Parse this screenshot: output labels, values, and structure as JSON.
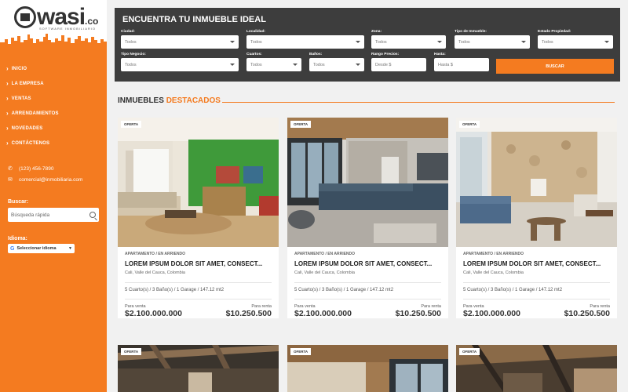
{
  "brand": {
    "name": "wasi",
    "suffix": ".co",
    "tagline": "SOFTWARE INMOBILIARIO"
  },
  "sidebar": {
    "nav": [
      {
        "label": "INICIO"
      },
      {
        "label": "LA EMPRESA"
      },
      {
        "label": "VENTAS"
      },
      {
        "label": "ARRENDAMIENTOS"
      },
      {
        "label": "NOVEDADES"
      },
      {
        "label": "CONTÁCTENOS"
      }
    ],
    "phone": "(123) 456-7890",
    "email": "comercial@inmobiliaria.com",
    "search_label": "Buscar:",
    "search_placeholder": "Búsqueda rápida",
    "language_label": "Idioma:",
    "language_select": "Seleccionar idioma"
  },
  "search": {
    "title": "ENCUENTRA TU INMUEBLE IDEAL",
    "fields": [
      {
        "label": "Ciudad:",
        "value": "Todos"
      },
      {
        "label": "Localidad:",
        "value": "Todos"
      },
      {
        "label": "Zona:",
        "value": "Todos"
      },
      {
        "label": "Tipo de Inmueble:",
        "value": "Todos"
      },
      {
        "label": "Estado Propiedad:",
        "value": "Todos"
      },
      {
        "label": "Tipo Negocio:",
        "value": "Todos"
      },
      {
        "label": "Cuartos:",
        "value": "Todos"
      },
      {
        "label": "Baños:",
        "value": "Todos"
      },
      {
        "label": "Rango Precios:",
        "value": "Desde $"
      },
      {
        "label": "Hasta:",
        "value": "Hasta $"
      }
    ],
    "button": "BUSCAR"
  },
  "featured": {
    "title": "INMUEBLES",
    "accent": "DESTACADOS"
  },
  "cards": [
    {
      "badge": "OFERTA",
      "type": "APARTAMENTO / EN ARRIENDO",
      "title": "LOREM IPSUM DOLOR SIT AMET, CONSECT...",
      "location": "Cali, Valle del Cauca, Colombia",
      "features": "5 Cuarto(s) / 3 Baño(s) / 1 Garage / 147.12 mt2",
      "sale_label": "Para venta",
      "sale_price": "$2.100.000.000",
      "rent_label": "Para renta",
      "rent_price": "$10.250.500"
    },
    {
      "badge": "OFERTA",
      "type": "APARTAMENTO / EN ARRIENDO",
      "title": "LOREM IPSUM DOLOR SIT AMET, CONSECT...",
      "location": "Cali, Valle del Cauca, Colombia",
      "features": "5 Cuarto(s) / 3 Baño(s) / 1 Garage / 147.12 mt2",
      "sale_label": "Para venta",
      "sale_price": "$2.100.000.000",
      "rent_label": "Para renta",
      "rent_price": "$10.250.500"
    },
    {
      "badge": "OFERTA",
      "type": "APARTAMENTO / EN ARRIENDO",
      "title": "LOREM IPSUM DOLOR SIT AMET, CONSECT...",
      "location": "Cali, Valle del Cauca, Colombia",
      "features": "5 Cuarto(s) / 3 Baño(s) / 1 Garage / 147.12 mt2",
      "sale_label": "Para venta",
      "sale_price": "$2.100.000.000",
      "rent_label": "Para renta",
      "rent_price": "$10.250.500"
    },
    {
      "badge": "OFERTA"
    },
    {
      "badge": "OFERTA"
    },
    {
      "badge": "OFERTA"
    }
  ],
  "colors": {
    "accent": "#f47b20",
    "panel": "#3d3d3d"
  }
}
